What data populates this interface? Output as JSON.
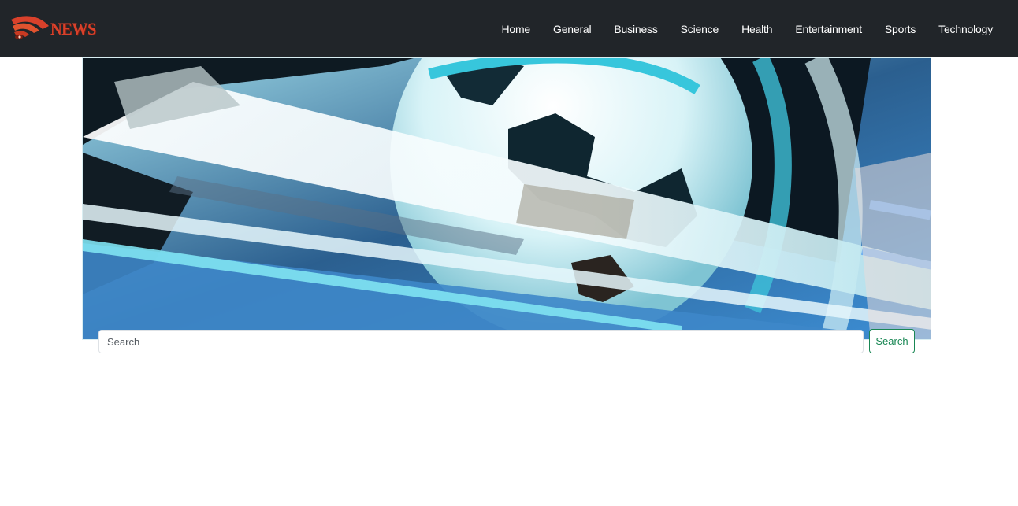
{
  "header": {
    "logo_text": "NEWS",
    "nav": [
      {
        "label": "Home"
      },
      {
        "label": "General"
      },
      {
        "label": "Business"
      },
      {
        "label": "Science"
      },
      {
        "label": "Health"
      },
      {
        "label": "Entertainment"
      },
      {
        "label": "Sports"
      },
      {
        "label": "Technology"
      }
    ]
  },
  "search": {
    "placeholder": "Search",
    "button_label": "Search"
  },
  "colors": {
    "navbar_bg": "#212529",
    "logo_red": "#d9412b",
    "button_green": "#198754"
  }
}
